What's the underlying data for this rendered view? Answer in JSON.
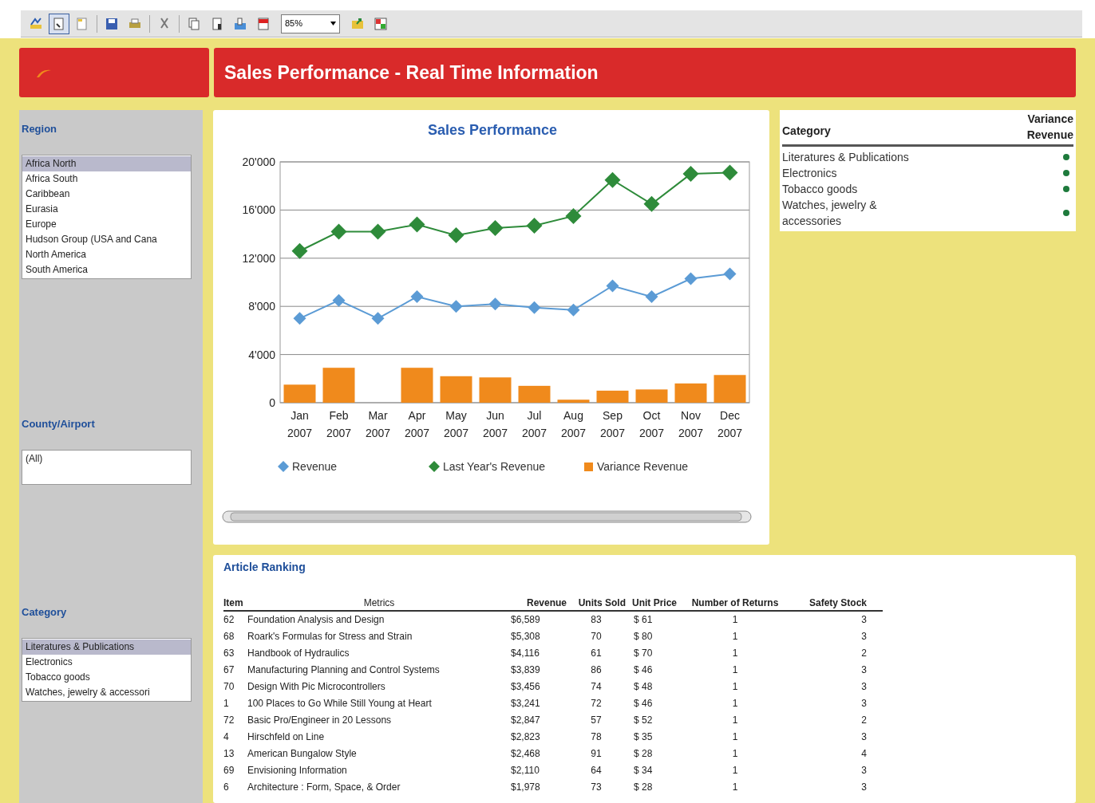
{
  "toolbar": {
    "buttons": [
      {
        "selected": false
      },
      {
        "selected": true
      },
      {
        "selected": false
      },
      {
        "selected": false
      },
      {
        "selected": false
      },
      {
        "selected": false
      },
      {
        "selected": false
      },
      {
        "selected": false
      },
      {
        "selected": false
      },
      {
        "selected": false
      }
    ],
    "zoom": "85%",
    "extra_buttons": [
      {
        "selected": false
      },
      {
        "selected": false
      }
    ]
  },
  "header": {
    "title": "Sales Performance - Real Time Information"
  },
  "filters": [
    {
      "kind": "list",
      "label": "Region",
      "items": [
        {
          "label": "Africa North",
          "selected": true
        },
        {
          "label": "Africa South",
          "selected": false
        },
        {
          "label": "Caribbean",
          "selected": false
        },
        {
          "label": "Eurasia",
          "selected": false
        },
        {
          "label": "Europe",
          "selected": false
        },
        {
          "label": "Hudson Group (USA and Cana",
          "selected": false
        },
        {
          "label": "North America",
          "selected": false
        },
        {
          "label": "South America",
          "selected": false
        }
      ]
    },
    {
      "kind": "list",
      "label": "County/Airport",
      "items": [
        {
          "label": "(All)",
          "selected": false
        }
      ]
    },
    {
      "kind": "list",
      "label": "Category",
      "items": [
        {
          "label": "Literatures & Publications",
          "selected": true
        },
        {
          "label": "Electronics",
          "selected": false
        },
        {
          "label": "Tobacco goods",
          "selected": false
        },
        {
          "label": "Watches, jewelry & accessori",
          "selected": false
        }
      ]
    }
  ],
  "chart_data": {
    "type": "line",
    "title": "Sales Performance",
    "categories": [
      "Jan 2007",
      "Feb 2007",
      "Mar 2007",
      "Apr 2007",
      "May 2007",
      "Jun 2007",
      "Jul 2007",
      "Aug 2007",
      "Sep 2007",
      "Oct 2007",
      "Nov 2007",
      "Dec 2007"
    ],
    "series": [
      {
        "name": "Revenue",
        "color": "#5b9bd5",
        "marker": "diamond",
        "values": [
          7000,
          8500,
          7000,
          8800,
          8000,
          8200,
          7900,
          7700,
          9700,
          8800,
          10300,
          10700
        ]
      },
      {
        "name": "Last Year's Revenue",
        "color": "#2e8b3a",
        "marker": "diamond",
        "values": [
          12600,
          14200,
          14200,
          14800,
          13900,
          14500,
          14700,
          15500,
          18500,
          16500,
          19000,
          19100
        ]
      },
      {
        "name": "Variance Revenue",
        "color": "#f08a1c",
        "type": "bar",
        "values": [
          1500,
          2900,
          0,
          2900,
          2200,
          2100,
          1400,
          250,
          1000,
          1100,
          1600,
          2300
        ]
      }
    ],
    "ylim": [
      0,
      20000
    ],
    "grid": true,
    "legend": true,
    "yticks": [
      {
        "value": 0,
        "label": "0"
      },
      {
        "value": 4000,
        "label": "4'000"
      },
      {
        "value": 8000,
        "label": "8'000"
      },
      {
        "value": 12000,
        "label": "12'000"
      },
      {
        "value": 16000,
        "label": "16'000"
      },
      {
        "value": 20000,
        "label": "20'000"
      }
    ]
  },
  "category_table": {
    "columns": [
      "Category",
      "Variance Revenue"
    ],
    "rows": [
      {
        "category": "Literatures & Publications",
        "color": "#1e7a3c"
      },
      {
        "category": "Electronics",
        "color": "#1e7a3c"
      },
      {
        "category": "Tobacco goods",
        "color": "#1e7a3c"
      },
      {
        "category": "Watches, jewelry & accessories",
        "color": "#1e7a3c"
      }
    ]
  },
  "article_ranking": {
    "title": "Article Ranking",
    "columns": [
      "Item",
      "Metrics",
      "Revenue",
      "Units Sold",
      "Unit Price",
      "Number of Returns",
      "Safety Stock"
    ],
    "rows": [
      [
        "62",
        "Foundation Analysis and Design",
        "$6,589",
        "83",
        "$ 61",
        "1",
        "3"
      ],
      [
        "68",
        "Roark's Formulas for Stress and Strain",
        "$5,308",
        "70",
        "$ 80",
        "1",
        "3"
      ],
      [
        "63",
        "Handbook of Hydraulics",
        "$4,116",
        "61",
        "$ 70",
        "1",
        "2"
      ],
      [
        "67",
        "Manufacturing Planning and Control Systems",
        "$3,839",
        "86",
        "$ 46",
        "1",
        "3"
      ],
      [
        "70",
        "Design With Pic Microcontrollers",
        "$3,456",
        "74",
        "$ 48",
        "1",
        "3"
      ],
      [
        "1",
        "100 Places to Go While Still Young at Heart",
        "$3,241",
        "72",
        "$ 46",
        "1",
        "3"
      ],
      [
        "72",
        "Basic Pro/Engineer in 20 Lessons",
        "$2,847",
        "57",
        "$ 52",
        "1",
        "2"
      ],
      [
        "4",
        "Hirschfeld on Line",
        "$2,823",
        "78",
        "$ 35",
        "1",
        "3"
      ],
      [
        "13",
        "American Bungalow Style",
        "$2,468",
        "91",
        "$ 28",
        "1",
        "4"
      ],
      [
        "69",
        "Envisioning Information",
        "$2,110",
        "64",
        "$ 34",
        "1",
        "3"
      ],
      [
        "6",
        "Architecture : Form, Space, & Order",
        "$1,978",
        "73",
        "$ 28",
        "1",
        "3"
      ]
    ]
  }
}
